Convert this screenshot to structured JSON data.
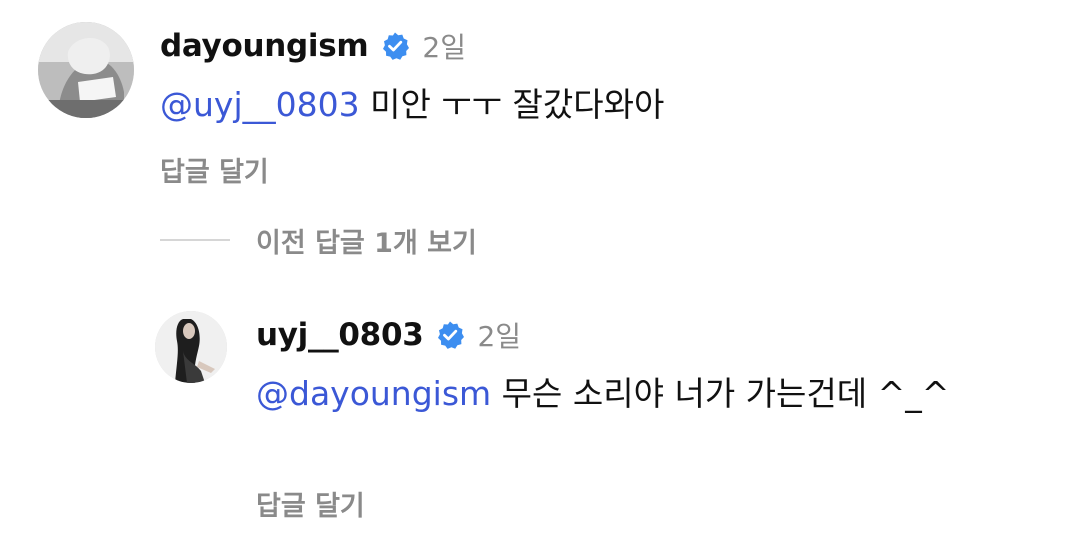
{
  "comment": {
    "username": "dayoungism",
    "verified": true,
    "time": "2일",
    "mention": "@uyj__0803",
    "text": " 미안 ㅜㅜ 잘갔다와아",
    "reply_label": "답글 달기",
    "avatar_icon": "profile-photo"
  },
  "view_replies": {
    "label": "이전 답글 1개 보기"
  },
  "reply": {
    "username": "uyj__0803",
    "verified": true,
    "time": "2일",
    "mention": "@dayoungism",
    "text": " 무슨 소리야 너가 가는건데 ^_^",
    "reply_label": "답글 달기",
    "avatar_icon": "profile-photo"
  },
  "colors": {
    "mention": "#3b58d6",
    "verified_badge": "#3d8ef0",
    "secondary_text": "#8a8a8a"
  }
}
